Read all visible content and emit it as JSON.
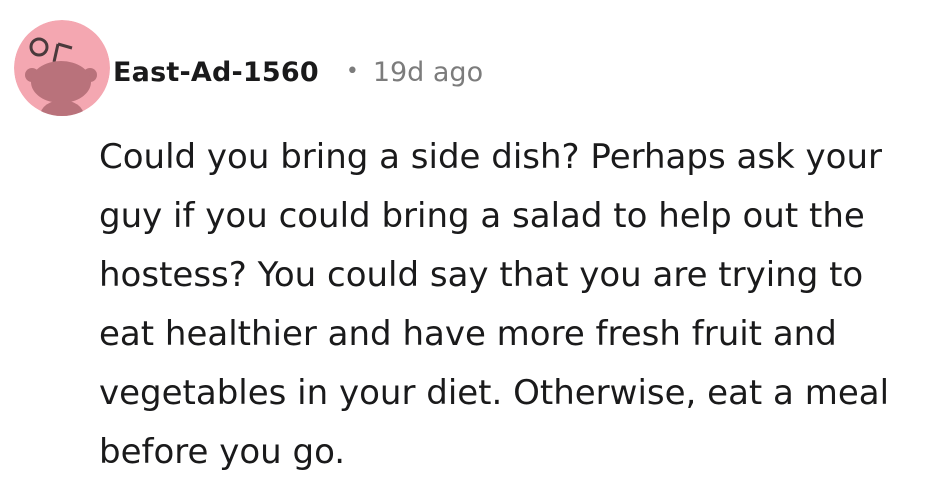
{
  "comment": {
    "author": "East-Ad-1560",
    "separator": "•",
    "timestamp": "19d ago",
    "avatar_icon": "reddit-snoo-avatar-icon",
    "avatar_color": "#f4a7b1",
    "body": "Could you bring a side dish? Perhaps ask your guy if you could bring a salad to help out the hostess? You could say that you are trying to eat healthier and have more fresh fruit and vegetables in your diet. Otherwise, eat a meal before you go."
  }
}
